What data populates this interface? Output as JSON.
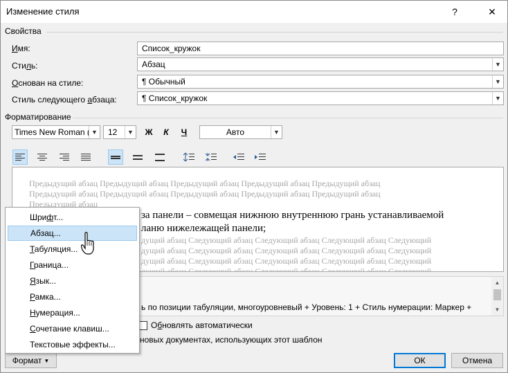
{
  "window": {
    "title": "Изменение стиля",
    "help": "?",
    "close": "✕"
  },
  "props": {
    "section": "Свойства",
    "name_label_pre": "",
    "name_label_u": "И",
    "name_label_post": "мя:",
    "name_value": "Список_кружок",
    "style_label_pre": "Сти",
    "style_label_u": "л",
    "style_label_post": "ь:",
    "style_value": "Абзац",
    "based_label_pre": "",
    "based_label_u": "О",
    "based_label_post": "снован на стиле:",
    "based_value": "¶  Обычный",
    "next_label_pre": "Стиль следующего ",
    "next_label_u": "а",
    "next_label_post": "бзаца:",
    "next_value": "¶  Список_кружок"
  },
  "formatting": {
    "section": "Форматирование",
    "font": "Times New Roman (О",
    "size": "12",
    "bold": "Ж",
    "italic": "К",
    "underline": "Ч",
    "color": "Авто"
  },
  "preview": {
    "prev_line1": "Предыдущий абзац Предыдущий абзац Предыдущий абзац Предыдущий абзац Предыдущий абзац",
    "prev_line2": "Предыдущий абзац Предыдущий абзац Предыдущий абзац Предыдущий абзац Предыдущий абзац",
    "prev_line3": "Предыдущий абзац",
    "main_line1": "за панели – совмещая нижнюю внутреннюю грань устанавливаемой",
    "main_line2": "ланю нижележащей панели;",
    "next_line1": "дущий абзац Следующий абзац Следующий абзац Следующий абзац Следующий",
    "next_line2": "дущий абзац Следующий абзац Следующий абзац Следующий абзац Следующий",
    "next_line3": "дущий абзац Следующий абзац Следующий абзац Следующий абзац Следующий",
    "next_line4": "дущий абзац Следующий абзац Следующий абзац Следующий абзац Следующий"
  },
  "description": "ь по позиции табуляции, многоуровневый + Уровень: 1 + Стиль нумерации: Маркер +",
  "options": {
    "auto_update_pre": "О",
    "auto_update_u": "б",
    "auto_update_post": "новлять автоматически",
    "template_text": "новых документах, использующих этот шаблон"
  },
  "menu": {
    "items": [
      {
        "pre": "Шри",
        "u": "ф",
        "post": "т..."
      },
      {
        "pre": "Абзац...",
        "u": "",
        "post": ""
      },
      {
        "pre": "",
        "u": "Т",
        "post": "абуляция..."
      },
      {
        "pre": "",
        "u": "Г",
        "post": "раница..."
      },
      {
        "pre": "",
        "u": "Я",
        "post": "зык..."
      },
      {
        "pre": "",
        "u": "Р",
        "post": "амка..."
      },
      {
        "pre": "",
        "u": "Н",
        "post": "умерация..."
      },
      {
        "pre": "",
        "u": "С",
        "post": "очетание клавиш..."
      },
      {
        "pre": "Текстовые эффекты...",
        "u": "",
        "post": ""
      }
    ]
  },
  "buttons": {
    "format": "Формат",
    "ok": "ОК",
    "cancel": "Отмена"
  }
}
